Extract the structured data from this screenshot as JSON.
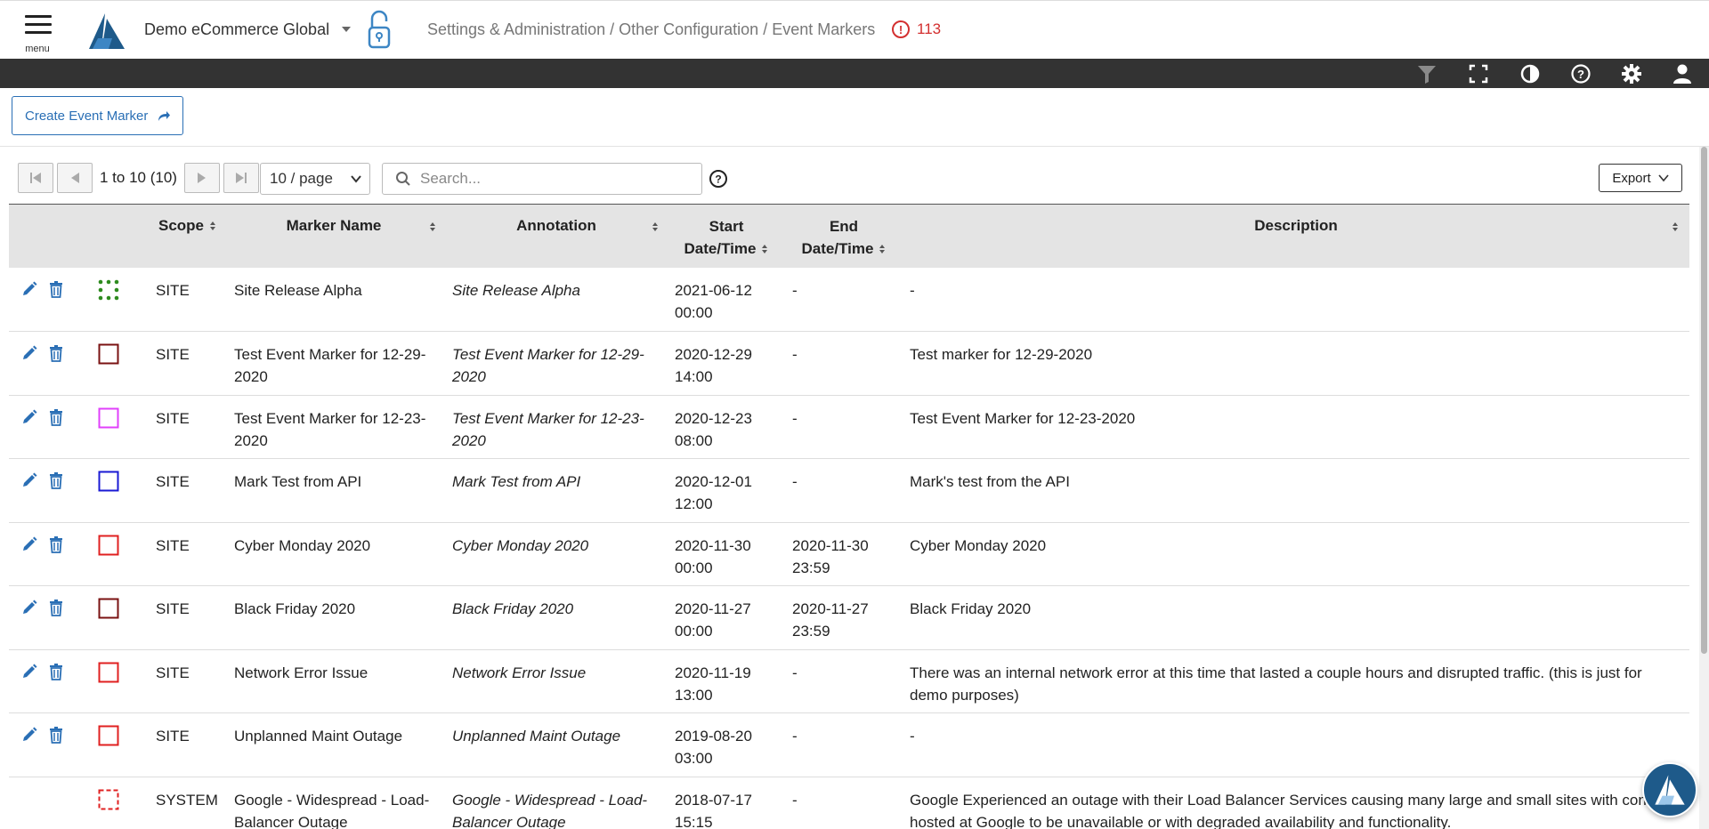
{
  "header": {
    "menu_label": "menu",
    "org_name": "Demo eCommerce Global",
    "breadcrumb": "Settings & Administration / Other Configuration / Event Markers",
    "alert_count": "113"
  },
  "toolbar": {
    "icons": [
      "filter-icon",
      "fullscreen-icon",
      "contrast-icon",
      "help-icon",
      "settings-icon",
      "user-icon"
    ]
  },
  "actions": {
    "create_label": "Create Event Marker",
    "export_label": "Export"
  },
  "pager": {
    "range": "1 to 10 (10)",
    "page_size": "10 / page",
    "search_placeholder": "Search..."
  },
  "table": {
    "columns": {
      "scope": "Scope",
      "marker_name": "Marker Name",
      "annotation": "Annotation",
      "start_1": "Start",
      "start_2": "Date/Time",
      "end_1": "End",
      "end_2": "Date/Time",
      "description": "Description"
    },
    "rows": [
      {
        "color": "#2e8b1f",
        "style": "dotted-grid",
        "scope": "SITE",
        "name": "Site Release Alpha",
        "annotation": "Site Release Alpha",
        "start_date": "2021-06-12",
        "start_time": "00:00",
        "end_date": "-",
        "end_time": "",
        "description": "-"
      },
      {
        "color": "#7a1212",
        "style": "solid",
        "scope": "SITE",
        "name": "Test Event Marker for 12-29-2020",
        "annotation": "Test Event Marker for 12-29-2020",
        "start_date": "2020-12-29",
        "start_time": "14:00",
        "end_date": "-",
        "end_time": "",
        "description": "Test marker for 12-29-2020"
      },
      {
        "color": "#e040fb",
        "style": "solid",
        "scope": "SITE",
        "name": "Test Event Marker for 12-23-2020",
        "annotation": "Test Event Marker for 12-23-2020",
        "start_date": "2020-12-23",
        "start_time": "08:00",
        "end_date": "-",
        "end_time": "",
        "description": "Test Event Marker for 12-23-2020"
      },
      {
        "color": "#1a1ad4",
        "style": "solid",
        "scope": "SITE",
        "name": "Mark Test from API",
        "annotation": "Mark Test from API",
        "start_date": "2020-12-01",
        "start_time": "12:00",
        "end_date": "-",
        "end_time": "",
        "description": "Mark's test from the API"
      },
      {
        "color": "#e02020",
        "style": "solid",
        "scope": "SITE",
        "name": "Cyber Monday 2020",
        "annotation": "Cyber Monday 2020",
        "start_date": "2020-11-30",
        "start_time": "00:00",
        "end_date": "2020-11-30",
        "end_time": "23:59",
        "description": "Cyber Monday 2020"
      },
      {
        "color": "#7a1212",
        "style": "solid",
        "scope": "SITE",
        "name": "Black Friday 2020",
        "annotation": "Black Friday 2020",
        "start_date": "2020-11-27",
        "start_time": "00:00",
        "end_date": "2020-11-27",
        "end_time": "23:59",
        "description": "Black Friday 2020"
      },
      {
        "color": "#e02020",
        "style": "solid",
        "scope": "SITE",
        "name": "Network Error Issue",
        "annotation": "Network Error Issue",
        "start_date": "2020-11-19",
        "start_time": "13:00",
        "end_date": "-",
        "end_time": "",
        "description": "There was an internal network error at this time that lasted a couple hours and disrupted traffic. (this is just for demo purposes)"
      },
      {
        "color": "#e02020",
        "style": "solid",
        "scope": "SITE",
        "name": "Unplanned Maint Outage",
        "annotation": "Unplanned Maint Outage",
        "start_date": "2019-08-20",
        "start_time": "03:00",
        "end_date": "-",
        "end_time": "",
        "description": "-"
      },
      {
        "color": "#e02020",
        "style": "dashed",
        "scope": "SYSTEM",
        "name": "Google - Widespread - Load-Balancer Outage",
        "annotation": "Google - Widespread - Load-Balancer Outage",
        "start_date": "2018-07-17",
        "start_time": "15:15",
        "end_date": "-",
        "end_time": "",
        "description": "Google Experienced an outage with their Load Balancer Services causing many large and small sites with content hosted at Google to be unavailable or with degraded availability and functionality."
      }
    ]
  }
}
